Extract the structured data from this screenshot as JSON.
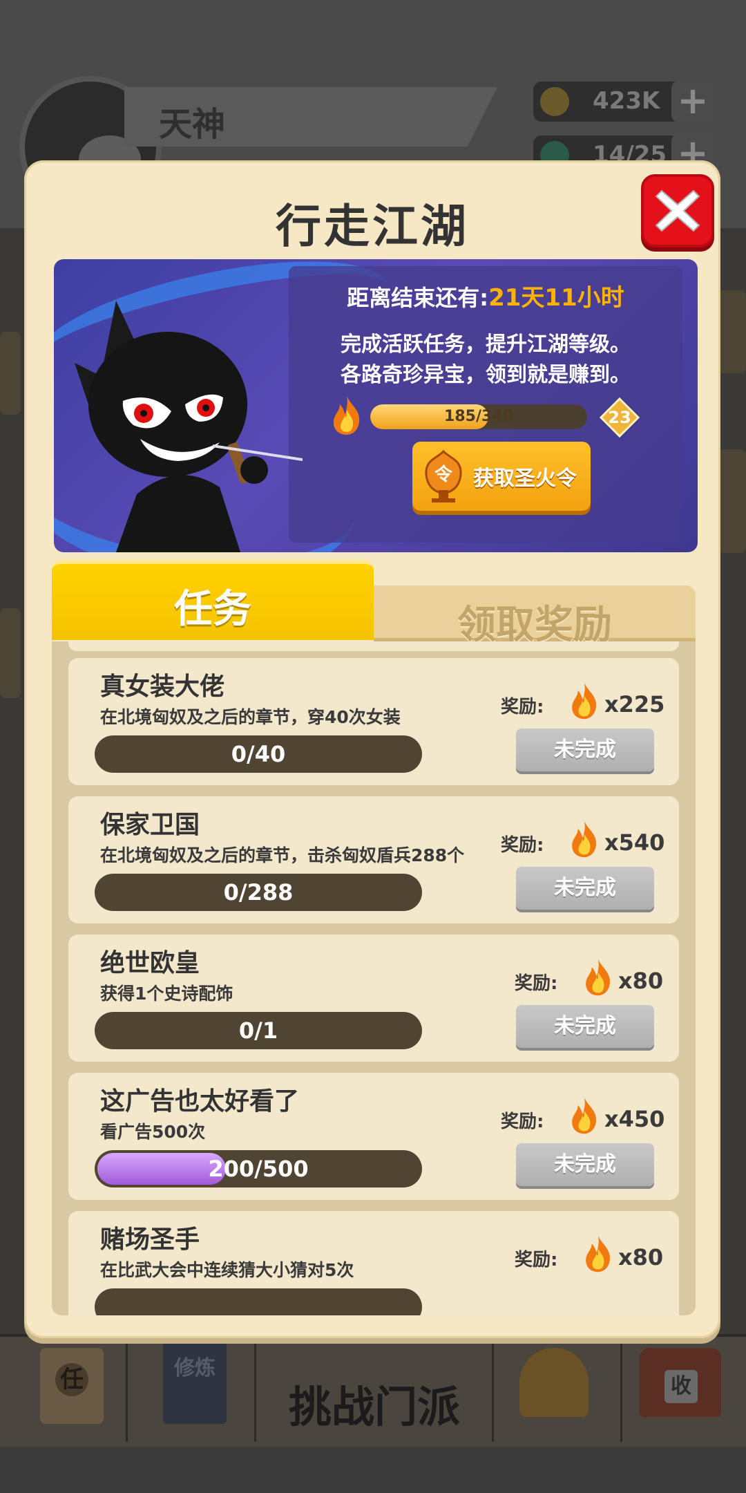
{
  "hud": {
    "player_name": "天神",
    "coins": "423K",
    "energy": "14/25",
    "plus": "+"
  },
  "bottom_nav": {
    "tasks_icon_text": "任",
    "cultivate_text": "修炼",
    "challenge_label": "挑战门派",
    "collect_icon_text": "收"
  },
  "modal": {
    "title": "行走江湖",
    "countdown_label": "距离结束还有:",
    "countdown_value": "21天11小时",
    "desc_line1": "完成活跃任务，提升江湖等级。",
    "desc_line2": "各路奇珍异宝，领到就是赚到。",
    "level_progress": {
      "current": 185,
      "total": 340,
      "text": "185/340"
    },
    "level": "23",
    "get_token_button": "获取圣火令",
    "token_badge_text": "令"
  },
  "tabs": {
    "active": "任务",
    "inactive": "领取奖励"
  },
  "tasks": [
    {
      "title": "真女装大佬",
      "desc": "在北境匈奴及之后的章节，穿40次女装",
      "progress_text": "0/40",
      "progress": 0,
      "reward_label": "奖励:",
      "reward_amount": "x225",
      "status": "未完成"
    },
    {
      "title": "保家卫国",
      "desc": "在北境匈奴及之后的章节，击杀匈奴盾兵288个",
      "progress_text": "0/288",
      "progress": 0,
      "reward_label": "奖励:",
      "reward_amount": "x540",
      "status": "未完成"
    },
    {
      "title": "绝世欧皇",
      "desc": "获得1个史诗配饰",
      "progress_text": "0/1",
      "progress": 0,
      "reward_label": "奖励:",
      "reward_amount": "x80",
      "status": "未完成"
    },
    {
      "title": "这广告也太好看了",
      "desc": "看广告500次",
      "progress_text": "200/500",
      "progress": 0.4,
      "reward_label": "奖励:",
      "reward_amount": "x450",
      "status": "未完成"
    },
    {
      "title": "赌场圣手",
      "desc": "在比武大会中连续猜大小猜对5次",
      "progress_text": "",
      "progress": 0,
      "reward_label": "奖励:",
      "reward_amount": "x80",
      "status": ""
    }
  ],
  "colors": {
    "accent_yellow": "#ffd200",
    "highlight_orange": "#ffb300",
    "close_red": "#e4101a",
    "panel_cream": "#f6e7c5",
    "progress_purple": "#a25ad8"
  },
  "icons": [
    "close-icon",
    "flame-icon",
    "level-diamond-icon",
    "token-badge-icon",
    "coin-icon",
    "gem-icon"
  ]
}
